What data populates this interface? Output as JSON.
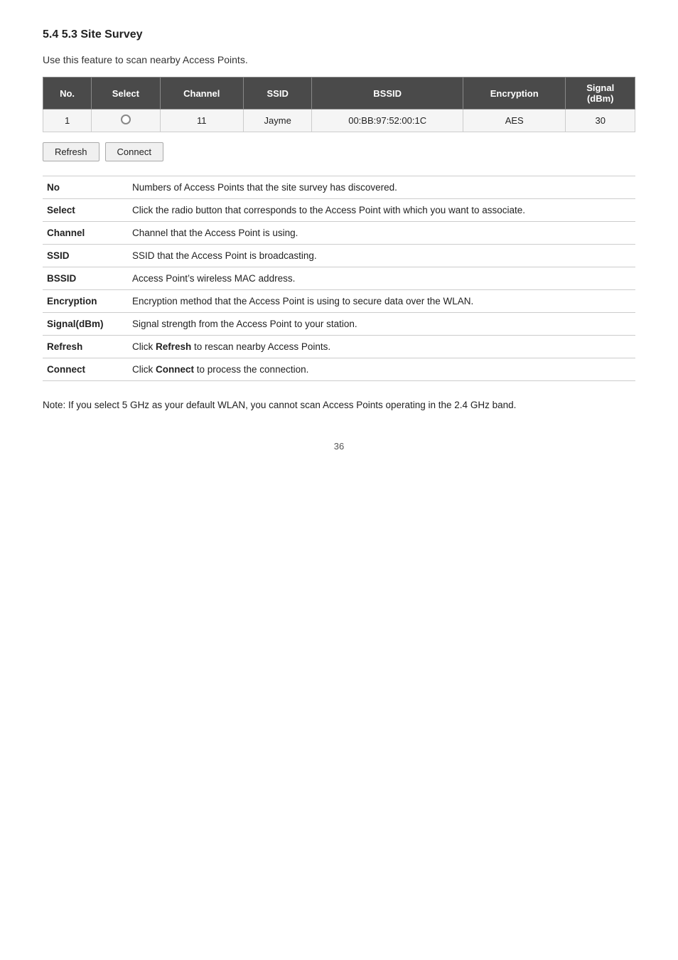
{
  "page": {
    "title": "5.4 5.3 Site Survey",
    "intro": "Use this feature to scan nearby Access Points.",
    "page_number": "36"
  },
  "table": {
    "headers": [
      "No.",
      "Select",
      "Channel",
      "SSID",
      "BSSID",
      "Encryption",
      "Signal\n(dBm)"
    ],
    "rows": [
      {
        "no": "1",
        "channel": "11",
        "ssid": "Jayme",
        "bssid": "00:BB:97:52:00:1C",
        "encryption": "AES",
        "signal": "30"
      }
    ]
  },
  "buttons": {
    "refresh": "Refresh",
    "connect": "Connect"
  },
  "descriptions": [
    {
      "term": "No",
      "definition": "Numbers of Access Points that the site survey has discovered."
    },
    {
      "term": "Select",
      "definition": "Click the radio button that corresponds to the Access Point with which you want to associate."
    },
    {
      "term": "Channel",
      "definition": "Channel that the Access Point is using."
    },
    {
      "term": "SSID",
      "definition": "SSID that the Access Point is broadcasting."
    },
    {
      "term": "BSSID",
      "definition": "Access Point’s wireless MAC address."
    },
    {
      "term": "Encryption",
      "definition": "Encryption method that the Access Point is using to secure data over the WLAN."
    },
    {
      "term": "Signal(dBm)",
      "definition": "Signal strength from the Access Point to your station."
    },
    {
      "term": "Refresh",
      "definition": "Click <b>Refresh</b> to rescan nearby Access Points."
    },
    {
      "term": "Connect",
      "definition": "Click <b>Connect</b> to process the connection."
    }
  ],
  "note": "Note: If you select 5 GHz as your default WLAN, you cannot scan Access Points operating in the 2.4 GHz band."
}
